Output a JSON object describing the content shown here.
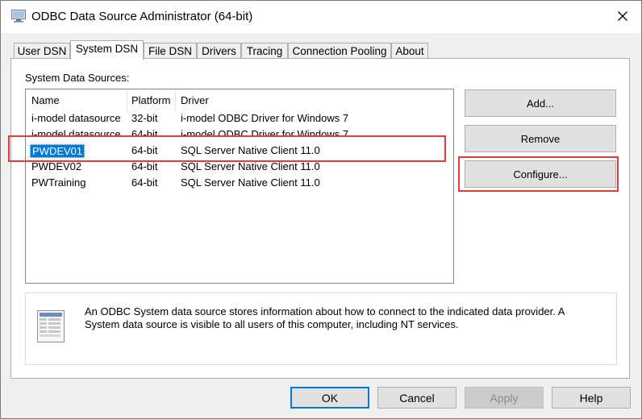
{
  "window": {
    "title": "ODBC Data Source Administrator (64-bit)"
  },
  "tabs": [
    {
      "label": "User DSN"
    },
    {
      "label": "System DSN"
    },
    {
      "label": "File DSN"
    },
    {
      "label": "Drivers"
    },
    {
      "label": "Tracing"
    },
    {
      "label": "Connection Pooling"
    },
    {
      "label": "About"
    }
  ],
  "active_tab": "System DSN",
  "system_dsn": {
    "label": "System Data Sources:",
    "columns": [
      "Name",
      "Platform",
      "Driver"
    ],
    "rows": [
      {
        "name": "i-model datasource",
        "platform": "32-bit",
        "driver": "i-model ODBC Driver for Windows 7"
      },
      {
        "name": "i-model datasource",
        "platform": "64-bit",
        "driver": "i-model ODBC Driver for Windows 7"
      },
      {
        "name": "PWDEV01",
        "platform": "64-bit",
        "driver": "SQL Server Native Client 11.0"
      },
      {
        "name": "PWDEV02",
        "platform": "64-bit",
        "driver": "SQL Server Native Client 11.0"
      },
      {
        "name": "PWTraining",
        "platform": "64-bit",
        "driver": "SQL Server Native Client 11.0"
      }
    ],
    "selected_row": "PWDEV01",
    "buttons": {
      "add": "Add...",
      "remove": "Remove",
      "configure": "Configure..."
    },
    "info_text": "An ODBC System data source stores information about how to connect to the indicated data provider.  A System data source is visible to all users of this computer, including NT services."
  },
  "footer": {
    "ok": "OK",
    "cancel": "Cancel",
    "apply": "Apply",
    "help": "Help"
  },
  "icons": {
    "app": "odbc-app-icon",
    "close": "close-icon",
    "info": "data-source-document-icon"
  },
  "colors": {
    "selection": "#0078d7",
    "highlight_annotation": "#e03c3c",
    "default_button_border": "#0078d7"
  }
}
